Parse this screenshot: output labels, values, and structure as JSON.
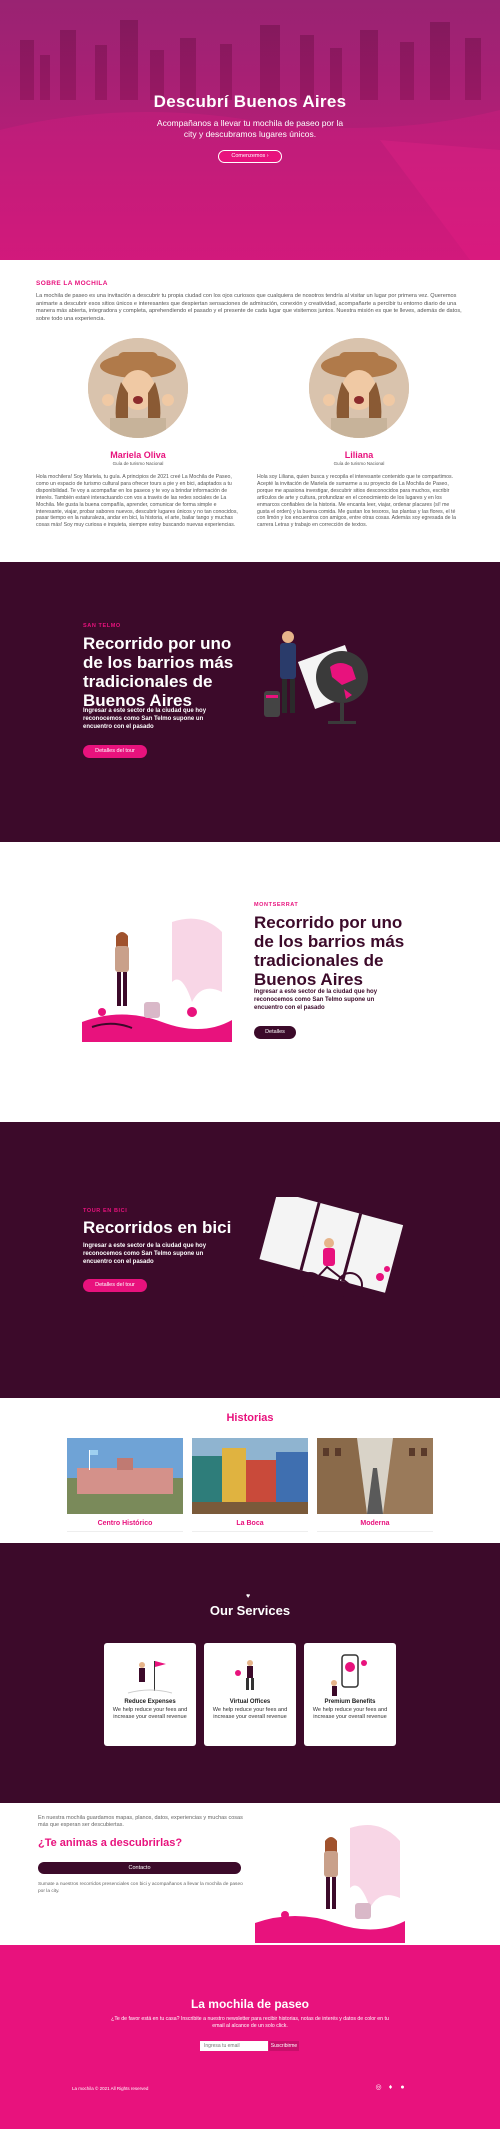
{
  "hero": {
    "title": "Descubrí Buenos Aires",
    "subtitle": "Acompañanos a llevar tu mochila de paseo por la city y descubramos lugares únicos.",
    "button": "Comenzemos ›"
  },
  "about": {
    "title": "SOBRE LA MOCHILA",
    "text": "La mochila de paseo es una invitación a descubrir tu propia ciudad con los ojos curiosos que cualquiera de nosotros tendría al visitar un lugar por primera vez. Queremos animarte a descubrir esos sitios únicos e interesantes que despiertan sensaciones de admiración, conexión y creatividad, acompañarte a percibir tu entorno diario de una manera más abierta, integradora y completa, aprehendiendo el pasado y el presente de cada lugar que visitemos juntos. Nuestra misión es que te lleves, además de datos, sobre todo una experiencia.",
    "people": [
      {
        "name": "Mariela Oliva",
        "role": "Guía de turismo Nacional",
        "bio": "Hola mochilera! Soy Mariela, tu guía. A principios de 2021 creé La Mochila de Paseo, como un espacio de turismo cultural para ofrecer tours a pie y en bici, adaptados a tu disponibilidad. Te voy a acompañar en los paseos y te voy a brindar información de interés. También estaré interactuando con vos a través de las redes sociales de La Mochila. Me gusta la buena compañía, aprender, comunicar de forma simple e interesante, viajar, probar sabores nuevos, descubrir lugares únicos y no tan conocidos, pasar tiempo en la naturaleza, andar en bici, la historia, el arte, bailar tango y muchas cosas más! Soy muy curiosa e inquieta, siempre estoy buscando nuevas experiencias."
      },
      {
        "name": "Liliana",
        "role": "Guía de turismo Nacional",
        "bio": "Hola soy Liliana, quien busca y recopila el interesante contenido que te compartimos. Acepté la invitación de Mariela de sumarme a su proyecto de La Mochila de Paseo, porque me apasiona investigar, descubrir sitios desconocidos para muchos, escribir artículos de arte y cultura, profundizar en el conocimiento de los lugares y en los enmarcos confiables de la historia. Me encanta leer, viajar, ordenar placares (sí! me gusta el orden) y la buena comida. Me gustan los tesoros, las plantas y las flores, el té con limón y los encuentros con amigos, entre otras cosas. Además soy egresada de la carrera Letras y trabajo en corrección de textos."
      }
    ]
  },
  "features": [
    {
      "kicker": "SAN TELMO",
      "title": "Recorrido por uno de los barrios más tradicionales de Buenos Aires",
      "desc": "Ingresar a este sector de la ciudad que hoy reconocemos como San Telmo supone un encuentro con el pasado",
      "button": "Detalles del tour"
    },
    {
      "kicker": "MONTSERRAT",
      "title": "Recorrido por uno de los barrios más tradicionales de Buenos Aires",
      "desc": "Ingresar a este sector de la ciudad que hoy reconocemos como San Telmo supone un encuentro con el pasado",
      "button": "Detalles"
    },
    {
      "kicker": "TOUR EN BICI",
      "title": "Recorridos en bici",
      "desc": "Ingresar a este sector de la ciudad que hoy reconocemos como San Telmo supone un encuentro con el pasado",
      "button": "Detalles del tour"
    }
  ],
  "historias": {
    "title": "Historias",
    "cards": [
      "Centro Histórico",
      "La Boca",
      "Moderna"
    ]
  },
  "services": {
    "title": "Our Services",
    "items": [
      {
        "title": "Reduce Expenses",
        "text": "We help reduce your fees and increase your overall revenue"
      },
      {
        "title": "Virtual Offices",
        "text": "We help reduce your fees and increase your overall revenue"
      },
      {
        "title": "Premium Benefits",
        "text": "We help reduce your fees and increase your overall revenue"
      }
    ]
  },
  "cta": {
    "text": "En nuestra mochila guardamos mapas, planos, datos, experiencias y muchas cosas más que esperan ser descubiertas.",
    "title": "¿Te animas a descubrirlas?",
    "button": "Contacto",
    "foot": "Sumate a nuestros recorridos presenciales con bici y acompañanos a llevar la mochila de paseo por la city."
  },
  "footer": {
    "title": "La mochila de paseo",
    "text": "¿Te de favor está en tu casa? Inscribite a nuestro newsletter para recibir historias, notas de interés y datos de color en tu email al alcance de un solo click.",
    "input_placeholder": "Ingresa tu email",
    "subscribe": "Suscribirme",
    "copyright": "La mochila © 2021 All Rights reserved"
  },
  "colors": {
    "pink": "#e8127d",
    "dark": "#3c0a2a"
  }
}
